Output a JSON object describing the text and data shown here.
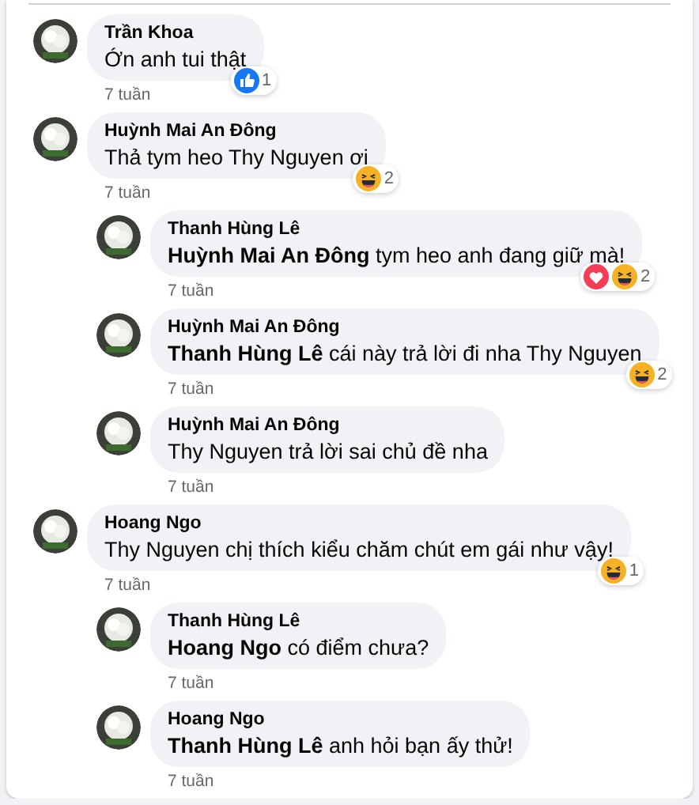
{
  "comments": [
    {
      "author": "Trần Khoa",
      "text": "Ớn anh tui thật",
      "time": "7 tuần",
      "reactions": [
        {
          "kind": "like"
        }
      ],
      "reaction_count": "1"
    },
    {
      "author": "Huỳnh Mai An Đông",
      "text": "Thả tym heo Thy Nguyen ơi",
      "time": "7 tuần",
      "reactions": [
        {
          "kind": "haha"
        }
      ],
      "reaction_count": "2",
      "replies": [
        {
          "author": "Thanh Hùng Lê",
          "text": "**Huỳnh Mai An Đông** tym heo anh đang giữ mà!",
          "time": "7 tuần",
          "reactions": [
            {
              "kind": "love"
            },
            {
              "kind": "haha"
            }
          ],
          "reaction_count": "2"
        },
        {
          "author": "Huỳnh Mai An Đông",
          "text": "**Thanh Hùng Lê** cái này trả lời đi nha Thy Nguyen",
          "time": "7 tuần",
          "reactions": [
            {
              "kind": "haha"
            }
          ],
          "reaction_count": "2"
        },
        {
          "author": "Huỳnh Mai An Đông",
          "text": "Thy Nguyen trả lời sai chủ đề nha",
          "time": "7 tuần"
        }
      ]
    },
    {
      "author": "Hoang Ngo",
      "text": "Thy Nguyen chị thích kiểu chăm chút em gái như vậy!",
      "time": "7 tuần",
      "reactions": [
        {
          "kind": "haha"
        }
      ],
      "reaction_count": "1",
      "replies": [
        {
          "author": "Thanh Hùng Lê",
          "text": "**Hoang Ngo** có điểm chưa?",
          "time": "7 tuần"
        },
        {
          "author": "Hoang Ngo",
          "text": "**Thanh Hùng Lê** anh hỏi bạn ấy thử!",
          "time": "7 tuần"
        }
      ]
    }
  ]
}
